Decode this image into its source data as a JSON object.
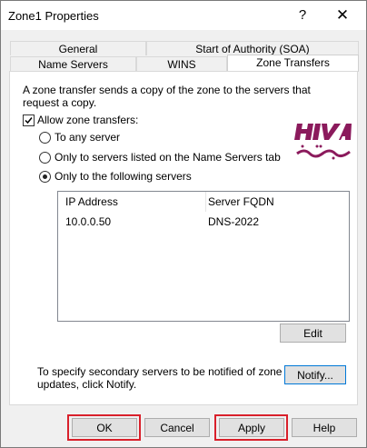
{
  "window": {
    "title": "Zone1 Properties",
    "help_glyph": "?",
    "close_glyph": "✕"
  },
  "tabs": {
    "row1": [
      "General",
      "Start of Authority (SOA)"
    ],
    "row2": [
      "Name Servers",
      "WINS",
      "Zone Transfers"
    ],
    "active": "Zone Transfers"
  },
  "zone_transfers": {
    "description": "A zone transfer sends a copy of the zone to the servers that request a copy.",
    "allow_label": "Allow zone transfers:",
    "allow_checked": true,
    "options": [
      {
        "label": "To any server",
        "selected": false
      },
      {
        "label": "Only to servers listed on the Name Servers tab",
        "selected": false
      },
      {
        "label": "Only to the following servers",
        "selected": true
      }
    ],
    "table": {
      "columns": [
        "IP Address",
        "Server FQDN"
      ],
      "rows": [
        [
          "10.0.0.50",
          "DNS-2022"
        ]
      ]
    },
    "edit_label": "Edit",
    "notify_text": "To specify secondary servers to be notified of zone updates, click Notify.",
    "notify_label": "Notify..."
  },
  "watermark": {
    "logo_text": "HIVA",
    "logo_subtext": "هیواشبکه",
    "color": "#8b1a5c"
  },
  "footer": {
    "ok": "OK",
    "cancel": "Cancel",
    "apply": "Apply",
    "help": "Help"
  },
  "colors": {
    "highlight": "#d9202b"
  }
}
